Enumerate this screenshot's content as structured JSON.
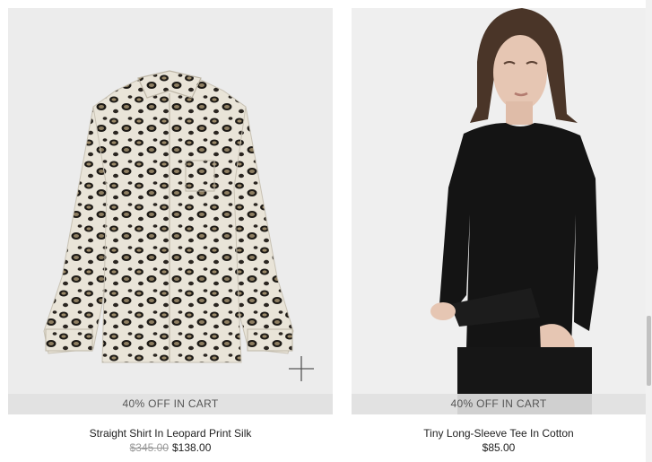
{
  "products": [
    {
      "name": "Straight Shirt In Leopard Print Silk",
      "original_price": "$345.00",
      "price": "$138.00",
      "promo": "40% OFF IN CART",
      "image_icon": "leopard-shirt-image"
    },
    {
      "name": "Tiny Long-Sleeve Tee In Cotton",
      "price": "$85.00",
      "promo": "40% OFF IN CART",
      "image_icon": "model-black-tee-image"
    }
  ],
  "colors": {
    "promo_bar": "#e1e1e1",
    "old_price": "#999999",
    "text": "#222222"
  }
}
